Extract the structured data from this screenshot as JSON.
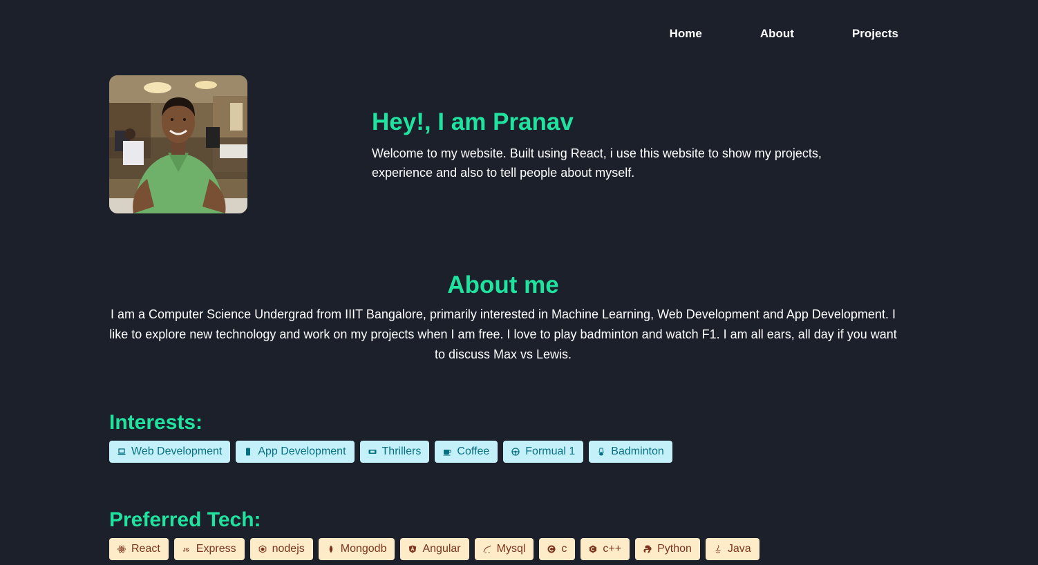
{
  "nav": {
    "home": "Home",
    "about": "About",
    "projects": "Projects"
  },
  "hero": {
    "title": "Hey!, I am Pranav",
    "description": "Welcome to my website. Built using React, i use this website to show my projects, experience and also to tell people about myself."
  },
  "about": {
    "title": "About me",
    "description": "I am a Computer Science Undergrad from IIIT Bangalore, primarily interested in Machine Learning, Web Development and App Development. I like to explore new technology and work on my projects when I am free. I love to play badminton and watch F1. I am all ears, all day if you want to discuss Max vs Lewis."
  },
  "interests": {
    "title": "Interests:",
    "items": [
      {
        "label": "Web Development",
        "icon": "laptop-icon"
      },
      {
        "label": "App Development",
        "icon": "mobile-icon"
      },
      {
        "label": "Thrillers",
        "icon": "ticket-icon"
      },
      {
        "label": "Coffee",
        "icon": "coffee-icon"
      },
      {
        "label": "Formual 1",
        "icon": "steering-wheel-icon"
      },
      {
        "label": "Badminton",
        "icon": "shuttlecock-icon"
      }
    ]
  },
  "tech": {
    "title": "Preferred Tech:",
    "items": [
      {
        "label": "React",
        "icon": "react-icon"
      },
      {
        "label": "Express",
        "icon": "js-icon"
      },
      {
        "label": "nodejs",
        "icon": "nodejs-icon"
      },
      {
        "label": "Mongodb",
        "icon": "mongodb-icon"
      },
      {
        "label": "Angular",
        "icon": "angular-icon"
      },
      {
        "label": "Mysql",
        "icon": "mysql-icon"
      },
      {
        "label": "c",
        "icon": "c-icon"
      },
      {
        "label": "c++",
        "icon": "cpp-icon"
      },
      {
        "label": "Python",
        "icon": "python-icon"
      },
      {
        "label": "Java",
        "icon": "java-icon"
      }
    ]
  },
  "colors": {
    "background": "#1b202b",
    "accent": "#20e3a0",
    "interest_tag_bg": "#c4f1f9",
    "interest_tag_text": "#086f83",
    "tech_tag_bg": "#feebc8",
    "tech_tag_text": "#7b341e"
  }
}
